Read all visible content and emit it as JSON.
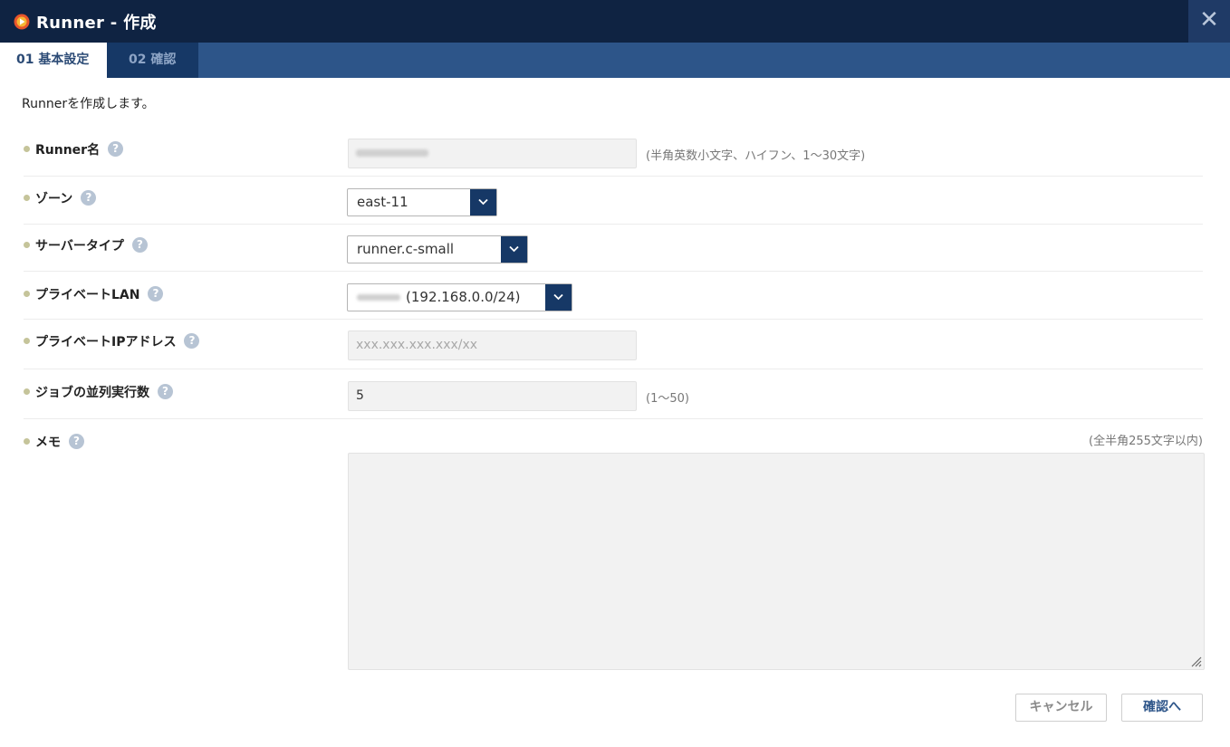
{
  "window": {
    "title": "Runner - 作成",
    "close_glyph": "✕"
  },
  "tabs": [
    {
      "label": "01 基本設定",
      "active": true
    },
    {
      "label": "02 確認",
      "active": false
    }
  ],
  "intro": "Runnerを作成します。",
  "form": {
    "runner_name": {
      "label": "Runner名",
      "hint": "(半角英数小文字、ハイフン、1〜30文字)"
    },
    "zone": {
      "label": "ゾーン",
      "value": "east-11"
    },
    "server_type": {
      "label": "サーバータイプ",
      "value": "runner.c-small"
    },
    "private_lan": {
      "label": "プライベートLAN",
      "value": "(192.168.0.0/24)"
    },
    "private_ip": {
      "label": "プライベートIPアドレス",
      "placeholder": "xxx.xxx.xxx.xxx/xx"
    },
    "concurrency": {
      "label": "ジョブの並列実行数",
      "value": "5",
      "hint": "(1〜50)"
    },
    "memo": {
      "label": "メモ",
      "hint": "(全半角255文字以内)"
    }
  },
  "buttons": {
    "cancel": "キャンセル",
    "confirm": "確認へ"
  },
  "colors": {
    "titlebar": "#0f2342",
    "tabbar": "#2d5589",
    "accent": "#163866"
  },
  "icons": [
    "app-logo-icon",
    "close-icon",
    "help-icon",
    "chevron-down-icon",
    "resize-grip-icon"
  ]
}
